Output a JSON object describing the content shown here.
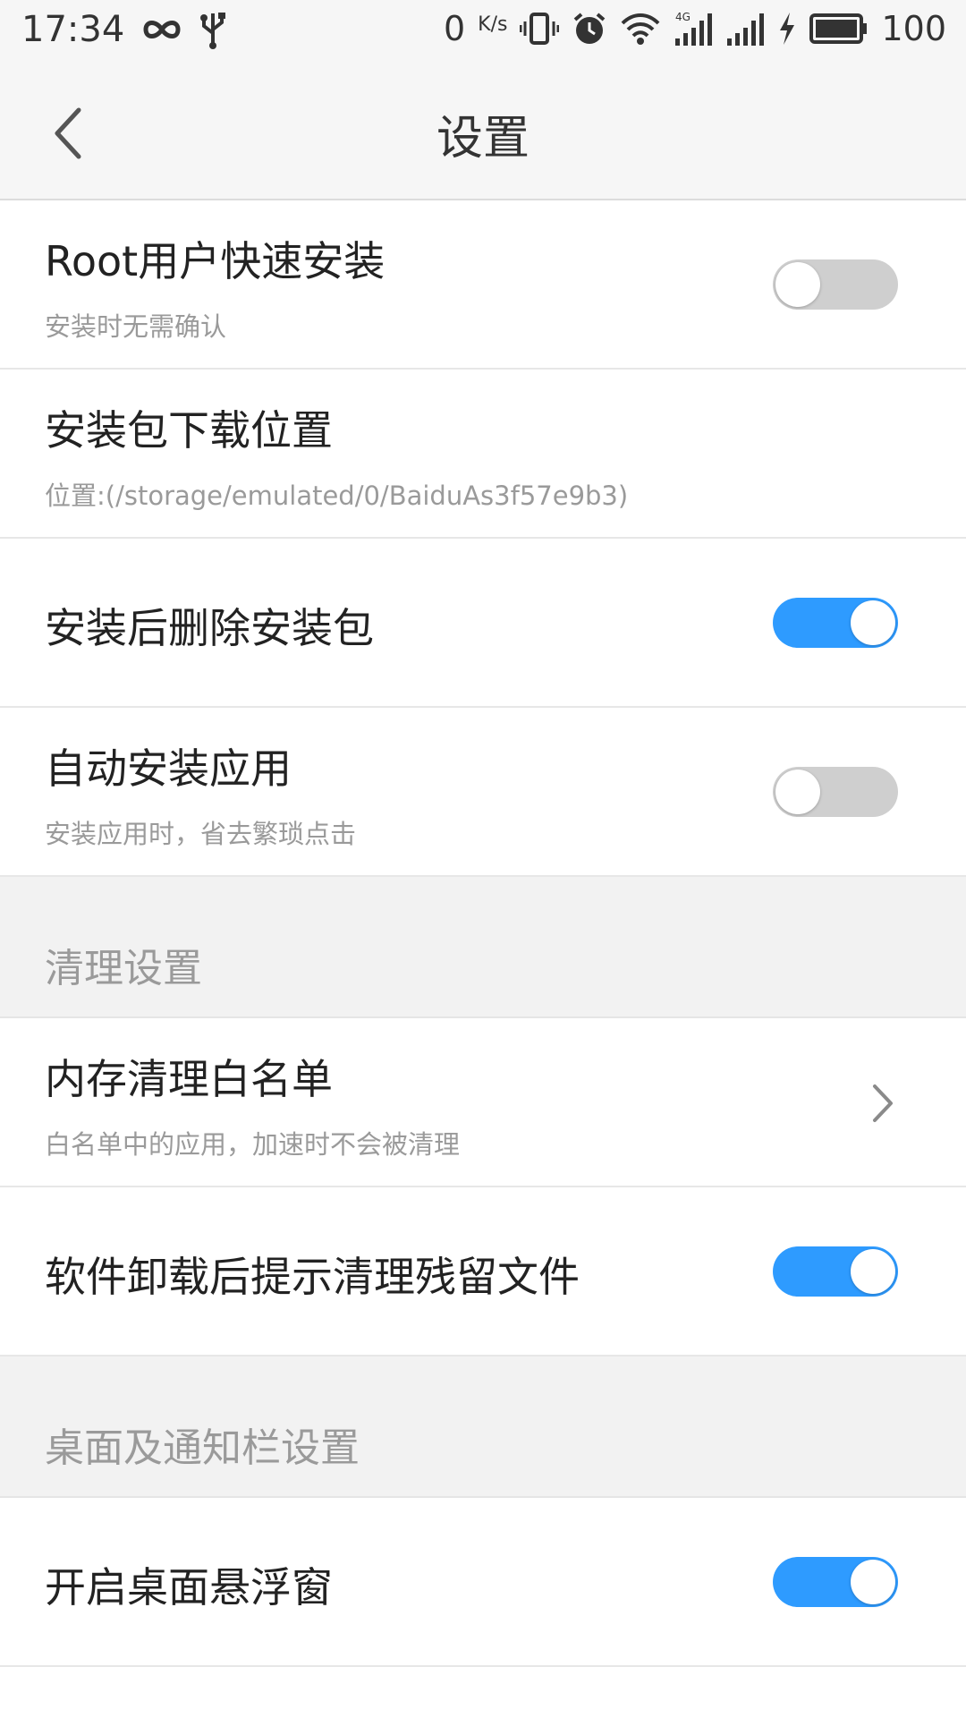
{
  "status_bar": {
    "time": "17:34",
    "speed_value": "0",
    "speed_unit": "K/s",
    "network": "4G",
    "battery": "100"
  },
  "app_bar": {
    "title": "设置"
  },
  "rows": {
    "root_install": {
      "title": "Root用户快速安装",
      "subtitle": "安装时无需确认",
      "toggle_on": false
    },
    "download_location": {
      "title": "安装包下载位置",
      "subtitle": "位置:(/storage/emulated/0/BaiduAs3f57e9b3)"
    },
    "delete_after_install": {
      "title": "安装后删除安装包",
      "toggle_on": true
    },
    "auto_install": {
      "title": "自动安装应用",
      "subtitle": "安装应用时，省去繁琐点击",
      "toggle_on": false
    },
    "memory_whitelist": {
      "title": "内存清理白名单",
      "subtitle": "白名单中的应用，加速时不会被清理"
    },
    "uninstall_cleanup": {
      "title": "软件卸载后提示清理残留文件",
      "toggle_on": true
    },
    "floating_window": {
      "title": "开启桌面悬浮窗",
      "toggle_on": true
    }
  },
  "sections": {
    "cleanup": "清理设置",
    "desktop_notification": "桌面及通知栏设置"
  },
  "colors": {
    "accent": "#2e9bff",
    "toggle_off": "#cfcfcf",
    "section_bg": "#f2f2f2"
  }
}
